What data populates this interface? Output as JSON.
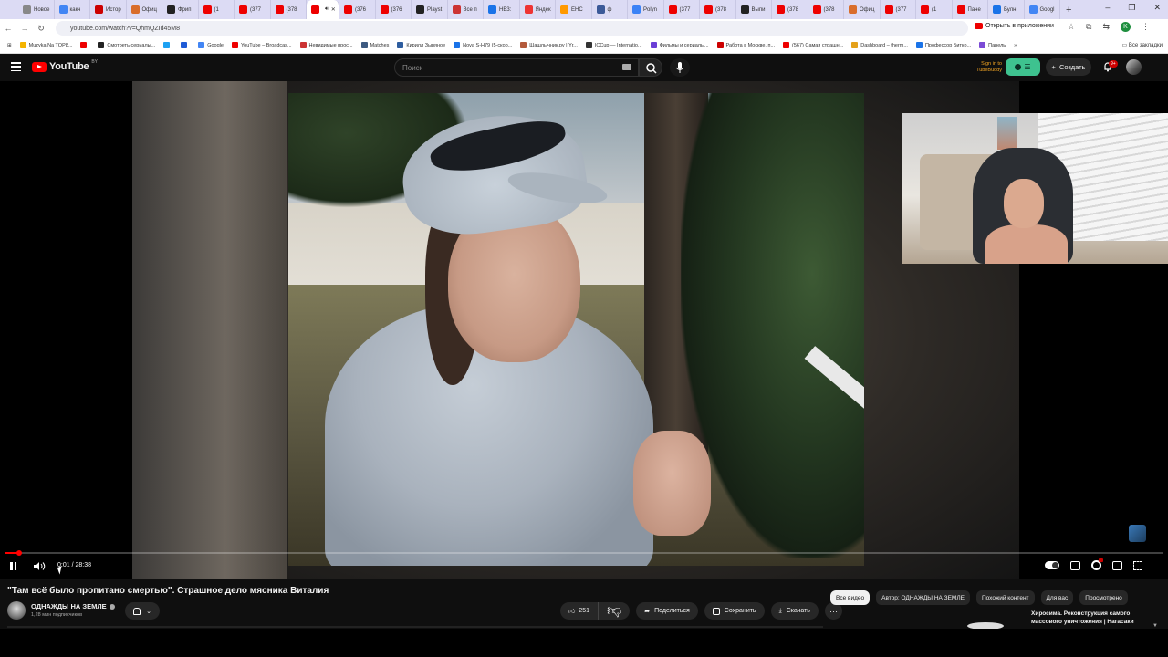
{
  "browser": {
    "tabs": [
      {
        "label": "Новое",
        "color": "#888"
      },
      {
        "label": "какч",
        "color": "#4285f4"
      },
      {
        "label": "Истор",
        "color": "#c00"
      },
      {
        "label": "Офиц",
        "color": "#d96d2b"
      },
      {
        "label": "Фрип",
        "color": "#222"
      },
      {
        "label": "(1",
        "color": "#e00"
      },
      {
        "label": "(377",
        "color": "#e00"
      },
      {
        "label": "(378",
        "color": "#e00"
      },
      {
        "label": "",
        "color": "#e00",
        "active": true
      },
      {
        "label": "(376",
        "color": "#e00"
      },
      {
        "label": "(376",
        "color": "#e00"
      },
      {
        "label": "Playst",
        "color": "#222"
      },
      {
        "label": "Все п",
        "color": "#c33"
      },
      {
        "label": "НВЗ:",
        "color": "#1a73e8"
      },
      {
        "label": "Яндек",
        "color": "#e33"
      },
      {
        "label": "ЕНС",
        "color": "#f90"
      },
      {
        "label": "ф",
        "color": "#3b5998"
      },
      {
        "label": "Polyn",
        "color": "#3b82f6"
      },
      {
        "label": "(377",
        "color": "#e00"
      },
      {
        "label": "(378",
        "color": "#e00"
      },
      {
        "label": "Выпи",
        "color": "#222"
      },
      {
        "label": "(378",
        "color": "#e00"
      },
      {
        "label": "(378",
        "color": "#e00"
      },
      {
        "label": "Офиц",
        "color": "#d96d2b"
      },
      {
        "label": "(377",
        "color": "#e00"
      },
      {
        "label": "(1",
        "color": "#e00"
      },
      {
        "label": "Пане",
        "color": "#e00"
      },
      {
        "label": "Булн",
        "color": "#1a73e8"
      },
      {
        "label": "Googl",
        "color": "#4285f4"
      }
    ],
    "new_tab": "+",
    "url": "youtube.com/watch?v=QhmQZId45M8",
    "open_in_app": "Открыть в приложении",
    "profile_letter": "K",
    "bookmarks": [
      {
        "label": "Muzyka Na TOP8...",
        "color": "#f4b400"
      },
      {
        "label": "",
        "color": "#e00"
      },
      {
        "label": "Смотреть сериалы...",
        "color": "#222"
      },
      {
        "label": "",
        "color": "#1da1f2"
      },
      {
        "label": "",
        "color": "#1e5bd6"
      },
      {
        "label": "Google",
        "color": "#4285f4"
      },
      {
        "label": "YouTube – Broadcas...",
        "color": "#e00"
      },
      {
        "label": "Невидимые прос...",
        "color": "#c33"
      },
      {
        "label": "Matches",
        "color": "#3d5a80"
      },
      {
        "label": "Кирилл Зыряное",
        "color": "#2e5d9f"
      },
      {
        "label": "Nova S-H79 (5-скор...",
        "color": "#1a73e8"
      },
      {
        "label": "Шашлычник.ру | Yr...",
        "color": "#b35a3c"
      },
      {
        "label": "ICCup — Internatio...",
        "color": "#333"
      },
      {
        "label": "Фильмы и сериалы...",
        "color": "#6a3fd6"
      },
      {
        "label": "Работа в Москве, п...",
        "color": "#c00"
      },
      {
        "label": "(567) Самая страшн...",
        "color": "#e00"
      },
      {
        "label": "Dashboard – therm...",
        "color": "#e4a11b"
      },
      {
        "label": "Профессор Битко...",
        "color": "#1a73e8"
      },
      {
        "label": "Панель",
        "color": "#7b4bd6"
      }
    ],
    "more_bookmarks": "»",
    "all_bookmarks": "Все закладки"
  },
  "youtube": {
    "logo_text": "YouTube",
    "region": "BY",
    "search_placeholder": "Поиск",
    "tubebuddy_line1": "Sign in to",
    "tubebuddy_line2": "TubeBuddy",
    "create_label": "Создать",
    "notifications_badge": "9+"
  },
  "player": {
    "time_current": "0:01",
    "time_separator": " / ",
    "time_total": "28:38",
    "progress_fraction": 0.012
  },
  "video": {
    "title": "\"Там всё было пропитано смертью\". Страшное дело мясника Виталия",
    "channel": "ОДНАЖДЫ НА ЗЕМЛЕ",
    "subscribers": "1,28 млн подписчиков",
    "likes": "251",
    "share": "Поделиться",
    "save": "Сохранить",
    "download": "Скачать",
    "more": "···"
  },
  "chips": [
    {
      "label": "Все видео",
      "active": true
    },
    {
      "label": "Автор: ОДНАЖДЫ НА ЗЕМЛЕ",
      "active": false
    },
    {
      "label": "Похожий контент",
      "active": false
    },
    {
      "label": "Для вас",
      "active": false
    },
    {
      "label": "Просмотрено",
      "active": false
    }
  ],
  "recommendation": {
    "title": "Хиросима. Реконструкция самого массового уничтожения | Нагасаки"
  },
  "colors": {
    "yt_red": "#ff0000",
    "bg": "#0f0f0f",
    "tubebuddy": "#3ec28f"
  }
}
